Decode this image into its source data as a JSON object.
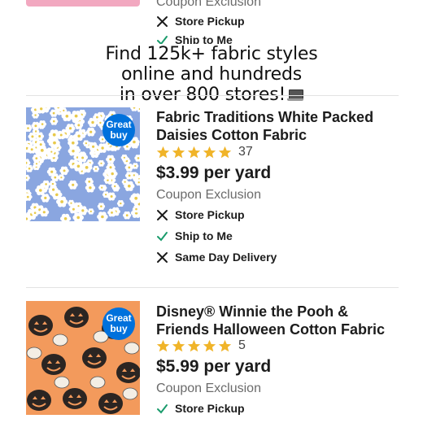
{
  "colors": {
    "accent_blue": "#0071dc",
    "star_gold": "#f0b429",
    "check_green": "#1a9b6c",
    "muted_text": "#6b6b6b"
  },
  "top_partial": {
    "coupon": "Coupon Exclusion",
    "pickup": "Store Pickup",
    "ship": "Ship to Me"
  },
  "caption": {
    "line1": "Find 125k+ fabric styles",
    "line2": "online and hundreds",
    "line3": "in over 800 stores!",
    "emoji_icon": "laptop-icon"
  },
  "products": [
    {
      "title": "Fabric Traditions White Packed Daisies Cotton Fabric",
      "badge": "Great buy",
      "rating": 5,
      "rating_count": "37",
      "price": "$3.99 per yard",
      "coupon": "Coupon Exclusion",
      "fulfillment": [
        {
          "label": "Store Pickup",
          "available": false
        },
        {
          "label": "Ship to Me",
          "available": true
        },
        {
          "label": "Same Day Delivery",
          "available": false
        }
      ]
    },
    {
      "title": "Disney® Winnie the Pooh & Friends Halloween Cotton Fabric",
      "badge": "Great buy",
      "rating": 5,
      "rating_count": "5",
      "price": "$5.99 per yard",
      "coupon": "Coupon Exclusion",
      "fulfillment": [
        {
          "label": "Store Pickup",
          "available": true
        }
      ]
    }
  ]
}
